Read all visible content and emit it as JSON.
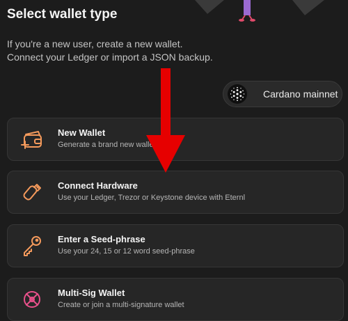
{
  "page": {
    "title": "Select wallet type",
    "intro_line1": "If you're a new user, create a new wallet.",
    "intro_line2": "Connect your Ledger or import a JSON backup."
  },
  "network": {
    "label": "Cardano mainnet",
    "icon": "cardano-logo-icon"
  },
  "options": [
    {
      "title": "New Wallet",
      "description": "Generate a brand new wallet",
      "icon": "wallet-add-icon"
    },
    {
      "title": "Connect Hardware",
      "description": "Use your Ledger, Trezor or Keystone device with Eternl",
      "icon": "usb-key-icon"
    },
    {
      "title": "Enter a Seed-phrase",
      "description": "Use your 24, 15 or 12 word seed-phrase",
      "icon": "key-icon"
    },
    {
      "title": "Multi-Sig Wallet",
      "description": "Create or join a multi-signature wallet",
      "icon": "multisig-icon"
    }
  ],
  "colors": {
    "accent": "#f59a5c",
    "annotation_arrow": "#e60000",
    "background": "#1c1c1c",
    "card": "#262626"
  }
}
